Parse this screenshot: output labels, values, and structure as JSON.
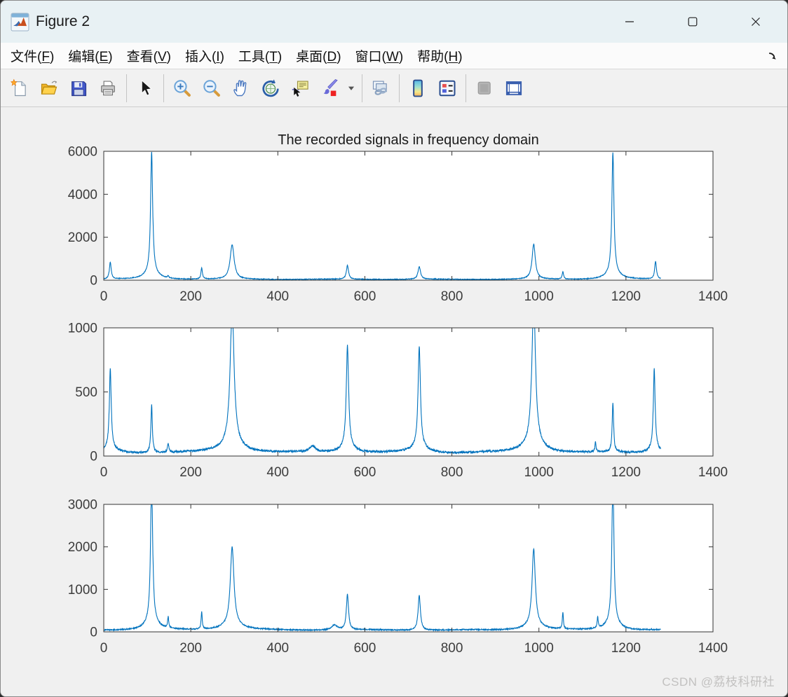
{
  "window": {
    "title": "Figure 2",
    "controls": {
      "minimize": "minimize",
      "maximize": "maximize",
      "close": "close"
    }
  },
  "menubar": {
    "items": [
      {
        "name": "file",
        "label": "文件",
        "key": "F"
      },
      {
        "name": "edit",
        "label": "编辑",
        "key": "E"
      },
      {
        "name": "view",
        "label": "查看",
        "key": "V"
      },
      {
        "name": "insert",
        "label": "插入",
        "key": "I"
      },
      {
        "name": "tools",
        "label": "工具",
        "key": "T"
      },
      {
        "name": "desktop",
        "label": "桌面",
        "key": "D"
      },
      {
        "name": "window",
        "label": "窗口",
        "key": "W"
      },
      {
        "name": "help",
        "label": "帮助",
        "key": "H"
      }
    ]
  },
  "toolbar": {
    "groups": [
      {
        "buttons": [
          {
            "name": "new-figure",
            "icon": "new-document-icon"
          },
          {
            "name": "open-file",
            "icon": "open-folder-icon"
          },
          {
            "name": "save-figure",
            "icon": "save-icon"
          },
          {
            "name": "print-figure",
            "icon": "print-icon"
          }
        ]
      },
      {
        "buttons": [
          {
            "name": "edit-plot",
            "icon": "edit-cursor-icon"
          }
        ]
      },
      {
        "buttons": [
          {
            "name": "zoom-in",
            "icon": "zoom-in-icon"
          },
          {
            "name": "zoom-out",
            "icon": "zoom-out-icon"
          },
          {
            "name": "pan",
            "icon": "pan-hand-icon"
          },
          {
            "name": "rotate-3d",
            "icon": "rotate-3d-icon"
          },
          {
            "name": "data-cursor",
            "icon": "data-cursor-icon"
          },
          {
            "name": "brush-data",
            "icon": "brush-icon"
          },
          {
            "name": "brush-dropdown",
            "icon": "caret-down-icon",
            "narrow": true
          }
        ]
      },
      {
        "buttons": [
          {
            "name": "link-plot",
            "icon": "link-icon"
          }
        ]
      },
      {
        "buttons": [
          {
            "name": "insert-colorbar",
            "icon": "colorbar-icon"
          },
          {
            "name": "insert-legend",
            "icon": "legend-icon"
          }
        ]
      },
      {
        "buttons": [
          {
            "name": "hide-plot-tools",
            "icon": "hide-plot-tools-icon",
            "disabled": true
          },
          {
            "name": "show-plot-tools",
            "icon": "show-plot-tools-icon"
          }
        ]
      }
    ]
  },
  "chart_data": [
    {
      "type": "line",
      "title": "The recorded signals in frequency domain",
      "xlim": [
        0,
        1400
      ],
      "ylim": [
        0,
        6000
      ],
      "xticks": [
        0,
        200,
        400,
        600,
        800,
        1000,
        1200,
        1400
      ],
      "yticks": [
        0,
        2000,
        4000,
        6000
      ],
      "line_color": "#0072BD",
      "axis_color": "#333333",
      "grid": false,
      "legend": null,
      "baseline": 40,
      "noise": 16,
      "data_end": 1280,
      "peaks": [
        {
          "x": 15,
          "y": 780,
          "w": 2.5
        },
        {
          "x": 110,
          "y": 5600,
          "w": 2.8
        },
        {
          "x": 148,
          "y": 90,
          "w": 2
        },
        {
          "x": 225,
          "y": 520,
          "w": 2
        },
        {
          "x": 295,
          "y": 1600,
          "w": 5.5
        },
        {
          "x": 560,
          "y": 640,
          "w": 3
        },
        {
          "x": 725,
          "y": 580,
          "w": 3.5
        },
        {
          "x": 988,
          "y": 1620,
          "w": 4.5
        },
        {
          "x": 1055,
          "y": 330,
          "w": 2
        },
        {
          "x": 1170,
          "y": 5550,
          "w": 2.8
        },
        {
          "x": 1268,
          "y": 820,
          "w": 2.5
        }
      ]
    },
    {
      "type": "line",
      "title": "",
      "xlim": [
        0,
        1400
      ],
      "ylim": [
        0,
        1000
      ],
      "xticks": [
        0,
        200,
        400,
        600,
        800,
        1000,
        1200,
        1400
      ],
      "yticks": [
        0,
        500,
        1000
      ],
      "line_color": "#0072BD",
      "axis_color": "#333333",
      "grid": false,
      "legend": null,
      "baseline": 25,
      "noise": 8,
      "data_end": 1280,
      "peaks": [
        {
          "x": 15,
          "y": 620,
          "w": 2.5
        },
        {
          "x": 110,
          "y": 370,
          "w": 2
        },
        {
          "x": 148,
          "y": 70,
          "w": 2
        },
        {
          "x": 295,
          "y": 1060,
          "w": 5.5
        },
        {
          "x": 480,
          "y": 45,
          "w": 8
        },
        {
          "x": 560,
          "y": 790,
          "w": 3.2
        },
        {
          "x": 725,
          "y": 780,
          "w": 3.2
        },
        {
          "x": 988,
          "y": 1120,
          "w": 5
        },
        {
          "x": 1130,
          "y": 75,
          "w": 1.5
        },
        {
          "x": 1170,
          "y": 380,
          "w": 2
        },
        {
          "x": 1265,
          "y": 620,
          "w": 2.5
        }
      ]
    },
    {
      "type": "line",
      "title": "",
      "xlim": [
        0,
        1400
      ],
      "ylim": [
        0,
        3000
      ],
      "xticks": [
        0,
        200,
        400,
        600,
        800,
        1000,
        1200,
        1400
      ],
      "yticks": [
        0,
        1000,
        2000,
        3000
      ],
      "line_color": "#0072BD",
      "axis_color": "#333333",
      "grid": false,
      "legend": null,
      "baseline": 40,
      "noise": 13,
      "data_end": 1280,
      "peaks": [
        {
          "x": 110,
          "y": 3400,
          "w": 2.8
        },
        {
          "x": 148,
          "y": 260,
          "w": 1.5
        },
        {
          "x": 225,
          "y": 410,
          "w": 1.5
        },
        {
          "x": 295,
          "y": 1850,
          "w": 5
        },
        {
          "x": 530,
          "y": 120,
          "w": 8
        },
        {
          "x": 560,
          "y": 830,
          "w": 3
        },
        {
          "x": 725,
          "y": 820,
          "w": 3.2
        },
        {
          "x": 988,
          "y": 1800,
          "w": 4.5
        },
        {
          "x": 1055,
          "y": 380,
          "w": 1.5
        },
        {
          "x": 1135,
          "y": 260,
          "w": 1.5
        },
        {
          "x": 1170,
          "y": 3400,
          "w": 2.8
        }
      ]
    }
  ],
  "watermark": {
    "text": "CSDN @荔枝科研社"
  }
}
